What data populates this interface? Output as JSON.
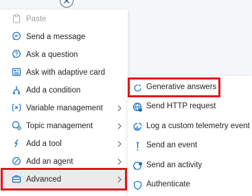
{
  "colors": {
    "accent": "#0f6cbd",
    "highlight": "#e3141c",
    "disabled": "#a0a0a0",
    "selected_bg": "#ebebeb"
  },
  "menu": {
    "items": [
      {
        "label": "Paste",
        "icon": "paste-icon",
        "disabled": true
      },
      {
        "label": "Send a message",
        "icon": "chat-bubble-icon"
      },
      {
        "label": "Ask a question",
        "icon": "question-bubble-icon"
      },
      {
        "label": "Ask with adaptive card",
        "icon": "adaptive-card-icon"
      },
      {
        "label": "Add a condition",
        "icon": "branch-icon"
      },
      {
        "label": "Variable management",
        "icon": "variable-icon",
        "submenu": true
      },
      {
        "label": "Topic management",
        "icon": "topic-icon",
        "submenu": true
      },
      {
        "label": "Add a tool",
        "icon": "tool-icon",
        "submenu": true
      },
      {
        "label": "Add an agent",
        "icon": "agent-icon",
        "submenu": true
      },
      {
        "label": "Advanced",
        "icon": "toolbox-icon",
        "submenu": true,
        "selected": true
      }
    ]
  },
  "submenu": {
    "items": [
      {
        "label": "Generative answers",
        "icon": "generative-answers-icon"
      },
      {
        "label": "Send HTTP request",
        "icon": "globe-icon"
      },
      {
        "label": "Log a custom telemetry event",
        "icon": "telemetry-icon"
      },
      {
        "label": "Send an event",
        "icon": "event-icon"
      },
      {
        "label": "Send an activity",
        "icon": "activity-icon"
      },
      {
        "label": "Authenticate",
        "icon": "shield-icon"
      }
    ]
  }
}
